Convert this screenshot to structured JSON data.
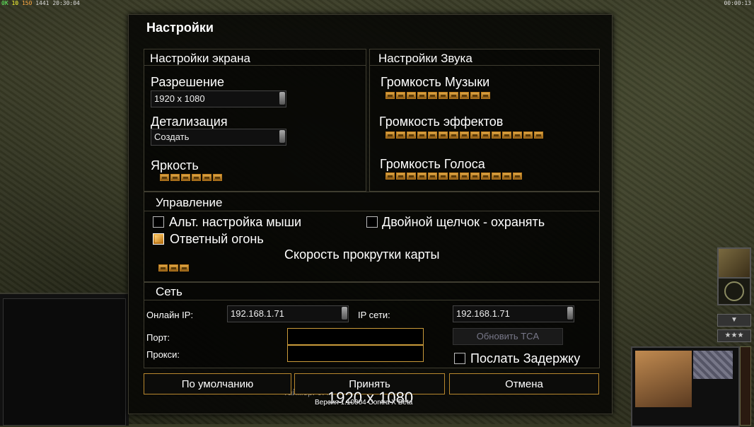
{
  "hud": {
    "fps_a": "0K",
    "fps_b": "10",
    "fps_c": "150",
    "fps_d": "1441",
    "clock": "20:30:04",
    "timer_right": "00:00:13"
  },
  "dialog": {
    "title": "Настройки",
    "display": {
      "header": "Настройки экрана",
      "resolution_label": "Разрешение",
      "resolution_value": "1920 x 1080",
      "detail_label": "Детализация",
      "detail_value": "Создать",
      "brightness_label": "Яркость",
      "brightness_level": 6
    },
    "sound": {
      "header": "Настройки Звука",
      "music_label": "Громкость Музыки",
      "music_level": 10,
      "effects_label": "Громкость эффектов",
      "effects_level": 15,
      "voice_label": "Громкость Голоса",
      "voice_level": 13
    },
    "controls": {
      "header": "Управление",
      "alt_mouse_label": "Альт. настройка мыши",
      "alt_mouse_checked": false,
      "double_click_label": "Двойной щелчок - охранять",
      "double_click_checked": false,
      "return_fire_label": "Ответный огонь",
      "return_fire_checked": true,
      "scroll_speed_label": "Скорость прокрутки карты",
      "scroll_speed_level": 3
    },
    "network": {
      "header": "Сеть",
      "online_ip_label": "Онлайн IP:",
      "online_ip_value": "192.168.1.71",
      "lan_ip_label": "IP сети:",
      "lan_ip_value": "192.168.1.71",
      "port_label": "Порт:",
      "port_value": "",
      "proxy_label": "Прокси:",
      "proxy_value": "",
      "update_tca_label": "Обновить TCA",
      "send_delay_label": "Послать Задержку",
      "send_delay_checked": false
    },
    "buttons": {
      "default": "По умолчанию",
      "accept": "Принять",
      "cancel": "Отмена"
    }
  },
  "footer": {
    "resolution_overlay": "1920 x 1080",
    "timer_ghost": "Таймер: 0:46",
    "version_text": "Версия 1.10004 Contra X Beta"
  },
  "colors": {
    "slider_segment": "#e3a845",
    "button_border": "#b8872e",
    "dialog_bg": "#080806"
  }
}
